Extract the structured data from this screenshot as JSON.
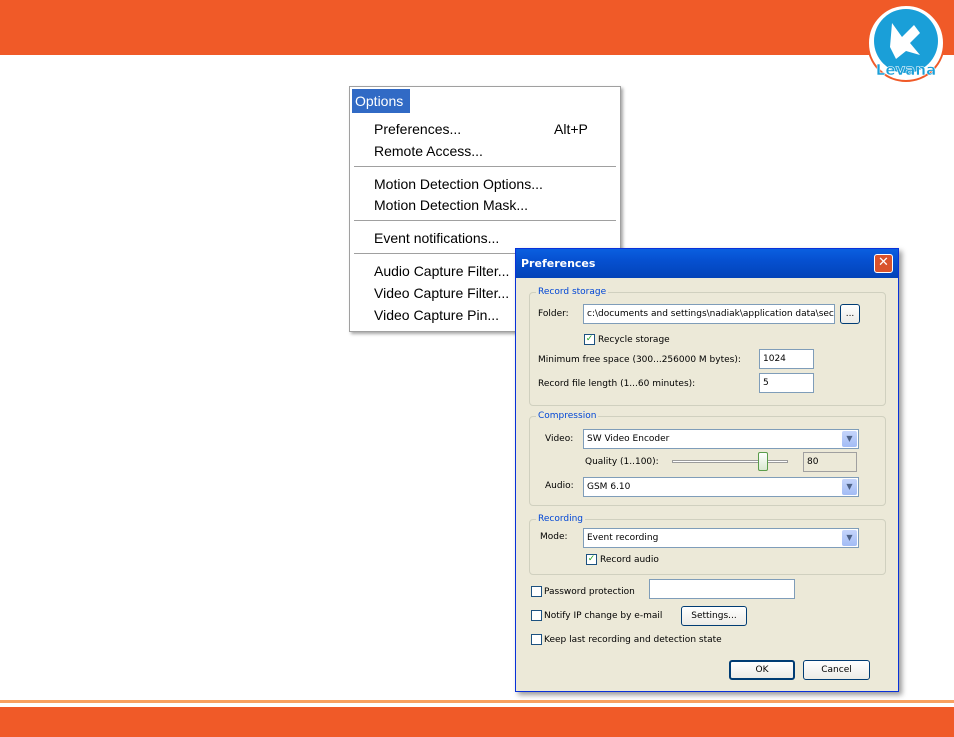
{
  "logo": {
    "text": "Levana"
  },
  "menu": {
    "title": "Options",
    "items": [
      {
        "label": "Preferences...",
        "accel": "Alt+P"
      },
      {
        "label": "Remote Access..."
      },
      {
        "label": "Motion Detection Options..."
      },
      {
        "label": "Motion Detection Mask..."
      },
      {
        "label": "Event notifications..."
      },
      {
        "label": "Audio Capture Filter..."
      },
      {
        "label": "Video Capture Filter..."
      },
      {
        "label": "Video Capture Pin..."
      }
    ]
  },
  "dialog": {
    "title": "Preferences",
    "close_icon": "close-icon",
    "record_storage": {
      "label": "Record storage",
      "folder_label": "Folder:",
      "folder_value": "c:\\documents and settings\\nadiak\\application data\\secu",
      "browse_label": "...",
      "recycle_label": "Recycle storage",
      "recycle_checked": true,
      "min_free_label": "Minimum free space (300...256000 M bytes):",
      "min_free_value": "1024",
      "file_length_label": "Record file length (1...60 minutes):",
      "file_length_value": "5"
    },
    "compression": {
      "label": "Compression",
      "video_label": "Video:",
      "video_value": "SW Video Encoder",
      "quality_label": "Quality (1..100):",
      "quality_value": "80",
      "audio_label": "Audio:",
      "audio_value": "GSM 6.10"
    },
    "recording": {
      "label": "Recording",
      "mode_label": "Mode:",
      "mode_value": "Event recording",
      "record_audio_label": "Record audio",
      "record_audio_checked": true
    },
    "password_label": "Password protection",
    "password_checked": false,
    "notify_label": "Notify IP change by e-mail",
    "notify_checked": false,
    "settings_label": "Settings...",
    "keep_label": "Keep last recording and detection state",
    "keep_checked": false,
    "ok_label": "OK",
    "cancel_label": "Cancel"
  }
}
